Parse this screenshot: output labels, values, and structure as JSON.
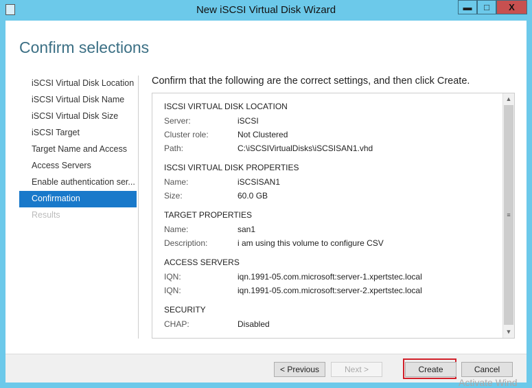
{
  "window": {
    "title": "New iSCSI Virtual Disk Wizard",
    "minimize": "▬",
    "maximize": "□",
    "close": "X"
  },
  "page_title": "Confirm selections",
  "nav": [
    {
      "label": "iSCSI Virtual Disk Location",
      "state": "normal"
    },
    {
      "label": "iSCSI Virtual Disk Name",
      "state": "normal"
    },
    {
      "label": "iSCSI Virtual Disk Size",
      "state": "normal"
    },
    {
      "label": "iSCSI Target",
      "state": "normal"
    },
    {
      "label": "Target Name and Access",
      "state": "normal"
    },
    {
      "label": "Access Servers",
      "state": "normal"
    },
    {
      "label": "Enable authentication ser...",
      "state": "normal"
    },
    {
      "label": "Confirmation",
      "state": "selected"
    },
    {
      "label": "Results",
      "state": "disabled"
    }
  ],
  "intro": "Confirm that the following are the correct settings, and then click Create.",
  "sections": [
    {
      "title": "ISCSI VIRTUAL DISK LOCATION",
      "rows": [
        {
          "k": "Server:",
          "v": "iSCSI"
        },
        {
          "k": "Cluster role:",
          "v": "Not Clustered"
        },
        {
          "k": "Path:",
          "v": "C:\\iSCSIVirtualDisks\\iSCSISAN1.vhd"
        }
      ]
    },
    {
      "title": "ISCSI VIRTUAL DISK PROPERTIES",
      "rows": [
        {
          "k": "Name:",
          "v": "iSCSISAN1"
        },
        {
          "k": "Size:",
          "v": "60.0 GB"
        }
      ]
    },
    {
      "title": "TARGET PROPERTIES",
      "rows": [
        {
          "k": "Name:",
          "v": "san1"
        },
        {
          "k": "Description:",
          "v": "i am using this volume to configure CSV"
        }
      ]
    },
    {
      "title": "ACCESS SERVERS",
      "rows": [
        {
          "k": "IQN:",
          "v": "iqn.1991-05.com.microsoft:server-1.xpertstec.local"
        },
        {
          "k": "IQN:",
          "v": "iqn.1991-05.com.microsoft:server-2.xpertstec.local"
        }
      ]
    },
    {
      "title": "SECURITY",
      "rows": [
        {
          "k": "CHAP:",
          "v": "Disabled"
        }
      ]
    }
  ],
  "buttons": {
    "previous": "< Previous",
    "next": "Next >",
    "create": "Create",
    "cancel": "Cancel"
  },
  "watermark": "Activate Wind",
  "colors": {
    "frame": "#6cc9ea",
    "selected": "#1979ca",
    "close": "#c75050",
    "highlight": "#d2202a"
  }
}
